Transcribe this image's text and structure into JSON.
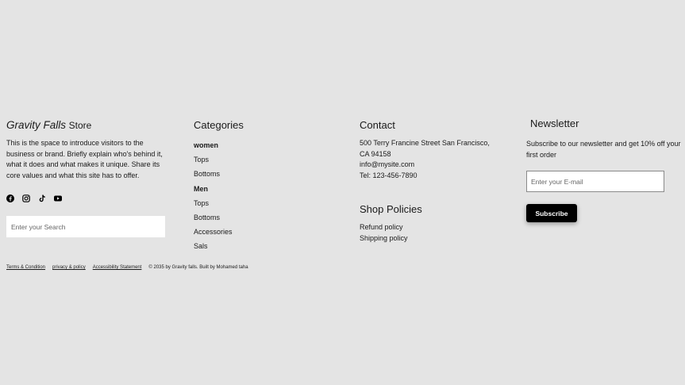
{
  "brand": {
    "name_italic": "Gravity Falls",
    "name_suffix": "Store",
    "description": "This is the space to introduce visitors to the business or brand. Briefly explain who's behind it, what it does and what makes it unique. Share its core values and what this site has to offer.",
    "social_icons": [
      "facebook-icon",
      "instagram-icon",
      "tiktok-icon",
      "youtube-icon"
    ],
    "search_placeholder": "Enter your Search"
  },
  "categories": {
    "heading": "Categories",
    "items": [
      {
        "label": "women",
        "bold": true
      },
      {
        "label": "Tops",
        "bold": false
      },
      {
        "label": "Bottoms",
        "bold": false
      },
      {
        "label": "Men",
        "bold": true
      },
      {
        "label": "Tops",
        "bold": false
      },
      {
        "label": "Bottoms",
        "bold": false
      },
      {
        "label": "Accessories",
        "bold": false
      },
      {
        "label": "Sals",
        "bold": false
      }
    ]
  },
  "contact": {
    "heading": "Contact",
    "address_line1": "500 Terry Francine Street San Francisco,",
    "address_line2": "CA 94158",
    "email": "info@mysite.com",
    "phone": "Tel: 123-456-7890"
  },
  "policies": {
    "heading": "Shop Policies",
    "refund": "Refund policy",
    "shipping": "Shipping policy"
  },
  "newsletter": {
    "heading": "Newsletter",
    "text": "Subscribe to our newsletter and get 10% off your first order",
    "email_placeholder": "Enter your E-mail",
    "button_label": "Subscribe"
  },
  "legal": {
    "terms": "Terms & Condition",
    "privacy": "privacy & policy",
    "accessibility": "Accessibility Statement",
    "copyright": "© 2035 by Gravity falls. Built by Mohamed taha"
  },
  "colors": {
    "background": "#e4e4e4",
    "button": "#000000",
    "button_text": "#ffffff"
  }
}
